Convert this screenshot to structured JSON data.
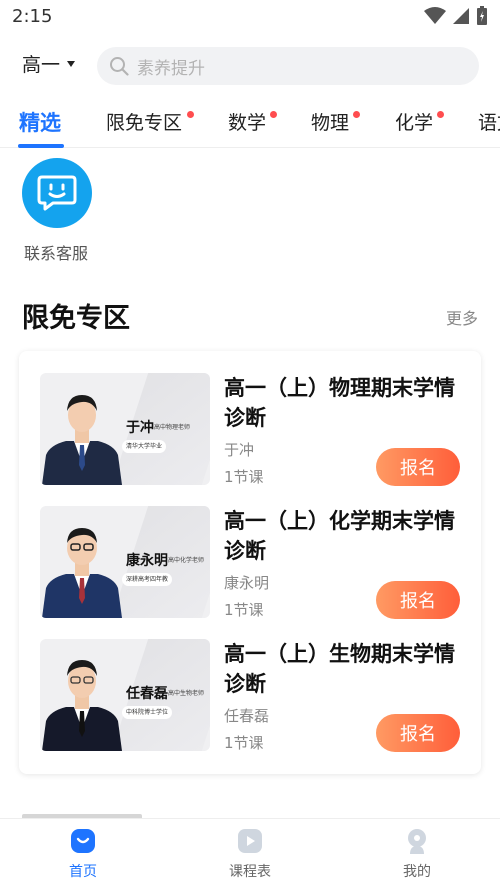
{
  "status_bar": {
    "time": "2:15"
  },
  "header": {
    "grade": "高一",
    "search_placeholder": "素养提升"
  },
  "tabs": [
    {
      "label": "精选",
      "active": true,
      "dot": false
    },
    {
      "label": "限免专区",
      "active": false,
      "dot": true
    },
    {
      "label": "数学",
      "active": false,
      "dot": true
    },
    {
      "label": "物理",
      "active": false,
      "dot": true
    },
    {
      "label": "化学",
      "active": false,
      "dot": true
    },
    {
      "label": "语文",
      "active": false,
      "dot": false
    }
  ],
  "service": {
    "label": "联系客服"
  },
  "section": {
    "title": "限免专区",
    "more": "更多"
  },
  "courses": [
    {
      "title": "高一（上）物理期末学情诊断",
      "teacher": "于冲",
      "lessons": "1节课",
      "button": "报名",
      "thumb_name": "于冲",
      "thumb_title": "高中物理老师",
      "thumb_tag": "清华大学毕业"
    },
    {
      "title": "高一（上）化学期末学情诊断",
      "teacher": "康永明",
      "lessons": "1节课",
      "button": "报名",
      "thumb_name": "康永明",
      "thumb_title": "高中化学老师",
      "thumb_tag": "深耕高考四年教"
    },
    {
      "title": "高一（上）生物期末学情诊断",
      "teacher": "任春磊",
      "lessons": "1节课",
      "button": "报名",
      "thumb_name": "任春磊",
      "thumb_title": "高中生物老师",
      "thumb_tag": "中科院博士学位"
    }
  ],
  "bottom_nav": [
    {
      "label": "首页",
      "icon": "home-icon",
      "active": true
    },
    {
      "label": "课程表",
      "icon": "schedule-icon",
      "active": false
    },
    {
      "label": "我的",
      "icon": "profile-icon",
      "active": false
    }
  ],
  "colors": {
    "accent": "#1e74ff",
    "signup": "#ff5e3a",
    "service": "#14a3ee",
    "dot": "#ff4d4f"
  }
}
